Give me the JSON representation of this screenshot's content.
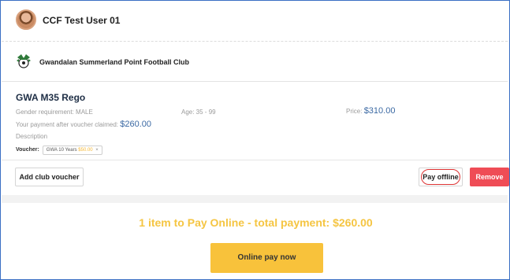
{
  "user": {
    "name": "CCF Test User 01"
  },
  "club": {
    "name": "Gwandalan Summerland Point Football Club"
  },
  "item": {
    "title": "GWA M35 Rego",
    "gender_label": "Gender requirement: MALE",
    "age_label": "Age: 35 - 99",
    "price_label": "Price:",
    "price_value": "$310.00",
    "after_voucher_label": "Your payment after voucher claimed:",
    "after_voucher_value": "$260.00",
    "description_label": "Description",
    "voucher_label": "Voucher:",
    "voucher_name": "GWA 10 Years",
    "voucher_amount": "$50.00",
    "voucher_remove_glyph": "×"
  },
  "buttons": {
    "add_voucher": "Add club voucher",
    "pay_offline": "Pay offline",
    "remove": "Remove",
    "pay_now": "Online pay now"
  },
  "summary": {
    "text": "1 item to Pay Online - total payment: $260.00"
  },
  "colors": {
    "frame": "#3a6fc4",
    "remove": "#ef4c56",
    "pay_now": "#f8c23b",
    "summary": "#f5c542",
    "annotation": "#d33"
  }
}
